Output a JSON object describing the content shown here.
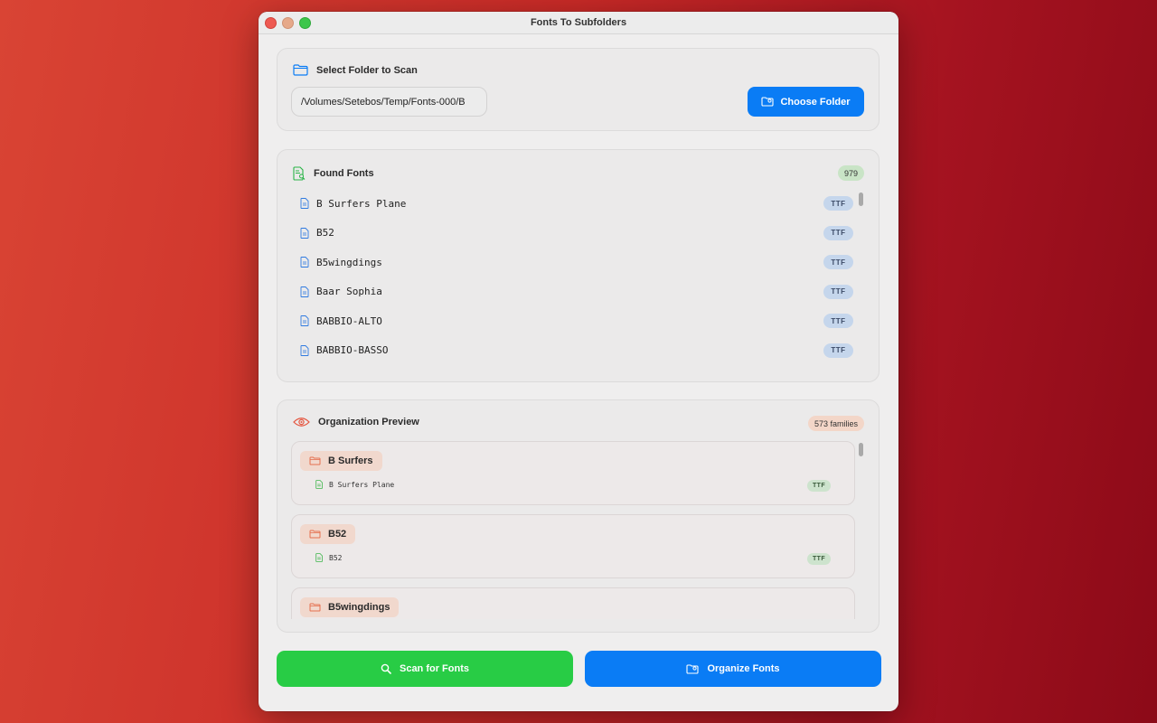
{
  "window": {
    "title": "Fonts To Subfolders"
  },
  "select_folder": {
    "title": "Select Folder to Scan",
    "path_value": "/Volumes/Setebos/Temp/Fonts-000/B",
    "choose_button": "Choose Folder"
  },
  "found_fonts": {
    "title": "Found Fonts",
    "count": "979",
    "items": [
      {
        "name": "B Surfers Plane",
        "type": "TTF"
      },
      {
        "name": "B52",
        "type": "TTF"
      },
      {
        "name": "B5wingdings",
        "type": "TTF"
      },
      {
        "name": "Baar Sophia",
        "type": "TTF"
      },
      {
        "name": "BABBIO-ALTO",
        "type": "TTF"
      },
      {
        "name": "BABBIO-BASSO",
        "type": "TTF"
      }
    ]
  },
  "organization_preview": {
    "title": "Organization Preview",
    "count": "573 families",
    "groups": [
      {
        "folder": "B Surfers",
        "file": "B Surfers Plane",
        "type": "TTF"
      },
      {
        "folder": "B52",
        "file": "B52",
        "type": "TTF"
      },
      {
        "folder": "B5wingdings",
        "file": "",
        "type": ""
      }
    ]
  },
  "actions": {
    "scan_button": "Scan for Fonts",
    "organize_button": "Organize Fonts"
  },
  "colors": {
    "accent_blue": "#0a7cf5",
    "accent_green": "#28cc45",
    "badge_green": "#c9e4c6",
    "badge_orange": "#f3d6c8",
    "ttf_blue": "#c5d6ec",
    "folder_orange": "#e5704f"
  },
  "icons": {
    "folder": "folder-icon",
    "found": "doc-search-icon",
    "file": "doc-icon",
    "preview": "eye-icon",
    "scan": "magnifier-icon",
    "organize": "folder-gear-icon"
  }
}
